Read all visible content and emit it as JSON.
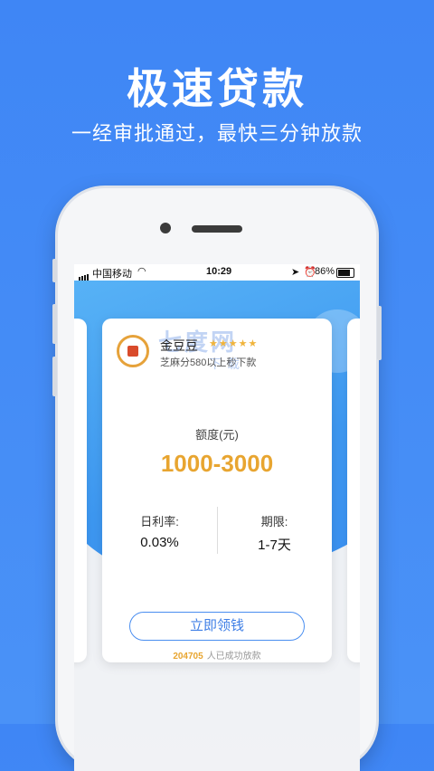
{
  "banner": {
    "title": "极速贷款",
    "subtitle": "一经审批通过，最快三分钟放款"
  },
  "statusbar": {
    "carrier": "中国移动",
    "time": "10:29",
    "battery": "86%"
  },
  "product": {
    "name": "金豆豆",
    "rating_stars": 5,
    "description": "芝麻分580以上秒下款",
    "watermark_main": "七度网",
    "watermark_sub": "下载"
  },
  "amount": {
    "label": "额度(元)",
    "value": "1000-3000"
  },
  "terms": {
    "rate_label": "日利率:",
    "rate_value": "0.03%",
    "period_label": "期限:",
    "period_value": "1-7天"
  },
  "cta_label": "立即领钱",
  "stats": {
    "count": "204705",
    "text": "人已成功放款"
  },
  "colors": {
    "background": "#3f86f5",
    "accent": "#e8a530",
    "button_border": "#4a8ef0"
  }
}
